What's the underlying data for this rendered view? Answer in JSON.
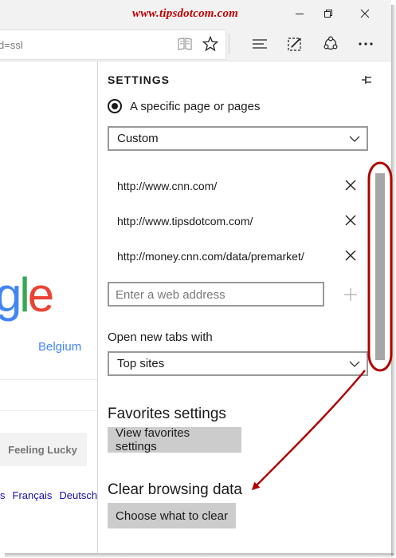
{
  "watermark": "www.tipsdotcom.com",
  "window_controls": {
    "minimize": "minimize",
    "maximize": "maximize",
    "close": "close"
  },
  "address_bar": {
    "value": "d=ssl"
  },
  "toolbar_icons": [
    "reading-view-icon",
    "favorite-star-icon",
    "hub-icon",
    "web-note-icon",
    "share-icon",
    "more-icon"
  ],
  "google": {
    "logo_partial": {
      "g": "g",
      "l": "l",
      "e": "e"
    },
    "region": "Belgium",
    "lucky_button": "Feeling Lucky",
    "languages": [
      "s",
      "Français",
      "Deutsch"
    ]
  },
  "settings": {
    "title": "SETTINGS",
    "radio_option": "A specific page or pages",
    "page_select": "Custom",
    "urls": [
      "http://www.cnn.com/",
      "http://www.tipsdotcom.com/",
      "http://money.cnn.com/data/premarket/"
    ],
    "web_address_placeholder": "Enter a web address",
    "new_tabs_label": "Open new tabs with",
    "new_tabs_select": "Top sites",
    "favorites_title": "Favorites settings",
    "favorites_button": "View favorites settings",
    "clear_title": "Clear browsing data",
    "clear_button": "Choose what to clear"
  },
  "colors": {
    "watermark": "#c00000",
    "annotation": "#b00000",
    "google_blue": "#4285f4",
    "google_green": "#34a853",
    "google_red": "#ea4335",
    "button_gray": "#cccccc"
  }
}
